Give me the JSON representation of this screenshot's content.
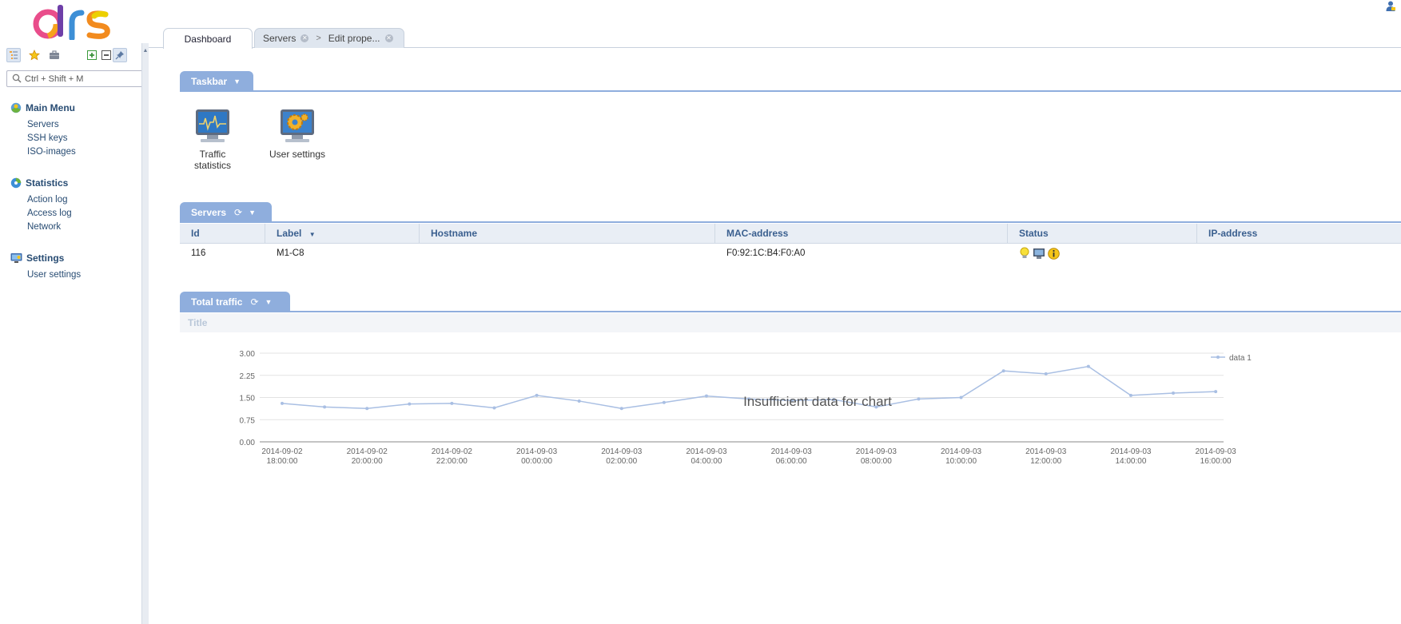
{
  "app": {
    "logo_text": "drs"
  },
  "sidebar": {
    "toolbar": [
      "tree-view-icon",
      "favorites-star-icon",
      "briefcase-icon",
      "expand-all-icon",
      "collapse-all-icon",
      "pin-icon"
    ],
    "search": {
      "placeholder": "Ctrl + Shift + M"
    },
    "groups": [
      {
        "title": "Main Menu",
        "icon": "main-menu-icon",
        "items": [
          "Servers",
          "SSH keys",
          "ISO-images"
        ]
      },
      {
        "title": "Statistics",
        "icon": "statistics-icon",
        "items": [
          "Action log",
          "Access log",
          "Network"
        ]
      },
      {
        "title": "Settings",
        "icon": "settings-icon",
        "items": [
          "User settings"
        ]
      }
    ]
  },
  "tabs": {
    "dashboard": "Dashboard",
    "servers": "Servers",
    "edit": "Edit prope...",
    "separator": ">"
  },
  "taskbar": {
    "title": "Taskbar",
    "items": [
      {
        "label_line1": "Traffic",
        "label_line2": "statistics",
        "icon": "traffic-monitor-icon"
      },
      {
        "label_line1": "User settings",
        "label_line2": "",
        "icon": "user-settings-gear-icon"
      }
    ]
  },
  "servers_panel": {
    "title": "Servers",
    "columns": [
      "Id",
      "Label",
      "Hostname",
      "MAC-address",
      "Status",
      "IP-address"
    ],
    "rows": [
      {
        "id": "116",
        "label": "M1-C8",
        "hostname": "",
        "mac": "F0:92:1C:B4:F0:A0",
        "status_icons": [
          "power-bulb-icon",
          "monitor-icon",
          "info-icon"
        ],
        "ip": ""
      }
    ]
  },
  "traffic_panel": {
    "title": "Total traffic",
    "chart_title_placeholder": "Title",
    "overlay_message": "Insufficient data for chart"
  },
  "colors": {
    "accent": "#8faedd",
    "link": "#284c73",
    "series": "#a9bfe3"
  },
  "chart_data": {
    "type": "line",
    "title": "",
    "xlabel": "",
    "ylabel": "",
    "ylim": [
      0,
      3
    ],
    "yticks": [
      "0.00",
      "0.75",
      "1.50",
      "2.25",
      "3.00"
    ],
    "xticks": [
      [
        "2014-09-02",
        "18:00:00"
      ],
      [
        "2014-09-02",
        "20:00:00"
      ],
      [
        "2014-09-02",
        "22:00:00"
      ],
      [
        "2014-09-03",
        "00:00:00"
      ],
      [
        "2014-09-03",
        "02:00:00"
      ],
      [
        "2014-09-03",
        "04:00:00"
      ],
      [
        "2014-09-03",
        "06:00:00"
      ],
      [
        "2014-09-03",
        "08:00:00"
      ],
      [
        "2014-09-03",
        "10:00:00"
      ],
      [
        "2014-09-03",
        "12:00:00"
      ],
      [
        "2014-09-03",
        "14:00:00"
      ],
      [
        "2014-09-03",
        "16:00:00"
      ]
    ],
    "grid": true,
    "legend_position": "right",
    "series": [
      {
        "name": "data 1",
        "x": [
          "2014-09-02 18:00",
          "2014-09-02 19:00",
          "2014-09-02 20:00",
          "2014-09-02 21:00",
          "2014-09-02 22:00",
          "2014-09-02 23:00",
          "2014-09-03 00:00",
          "2014-09-03 01:00",
          "2014-09-03 02:00",
          "2014-09-03 03:00",
          "2014-09-03 04:00",
          "2014-09-03 05:00",
          "2014-09-03 06:00",
          "2014-09-03 07:00",
          "2014-09-03 08:00",
          "2014-09-03 09:00",
          "2014-09-03 10:00",
          "2014-09-03 11:00",
          "2014-09-03 12:00",
          "2014-09-03 13:00",
          "2014-09-03 14:00",
          "2014-09-03 15:00",
          "2014-09-03 16:00"
        ],
        "values": [
          1.3,
          1.18,
          1.13,
          1.28,
          1.3,
          1.15,
          1.57,
          1.38,
          1.13,
          1.33,
          1.55,
          1.45,
          1.4,
          1.43,
          1.18,
          1.45,
          1.5,
          2.4,
          2.3,
          2.55,
          1.57,
          1.65,
          1.7
        ]
      }
    ]
  }
}
